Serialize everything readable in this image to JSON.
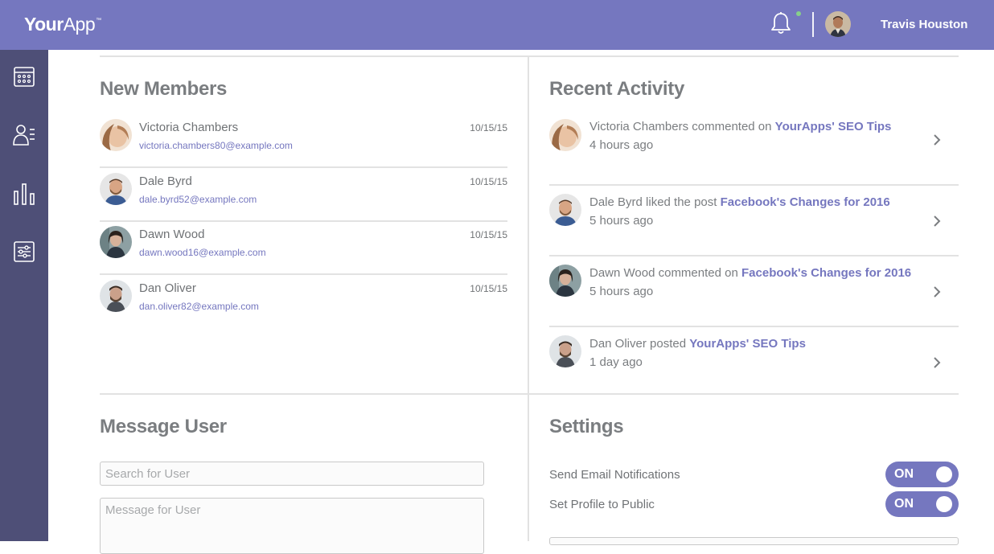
{
  "app": {
    "logo_bold": "Your",
    "logo_light": "App",
    "logo_tm": "™"
  },
  "header": {
    "user_name": "Travis Houston"
  },
  "new_members": {
    "title": "New Members",
    "items": [
      {
        "name": "Victoria Chambers",
        "email": "victoria.chambers80@example.com",
        "date": "10/15/15"
      },
      {
        "name": "Dale Byrd",
        "email": "dale.byrd52@example.com",
        "date": "10/15/15"
      },
      {
        "name": "Dawn Wood",
        "email": "dawn.wood16@example.com",
        "date": "10/15/15"
      },
      {
        "name": "Dan Oliver",
        "email": "dan.oliver82@example.com",
        "date": "10/15/15"
      }
    ]
  },
  "recent_activity": {
    "title": "Recent Activity",
    "items": [
      {
        "text": "Victoria Chambers commented on ",
        "link": "YourApps' SEO Tips",
        "time": "4 hours ago"
      },
      {
        "text": "Dale Byrd liked the post ",
        "link": "Facebook's Changes for 2016",
        "time": "5 hours ago"
      },
      {
        "text": "Dawn Wood commented on ",
        "link": "Facebook's Changes for 2016",
        "time": "5 hours ago"
      },
      {
        "text": "Dan Oliver posted ",
        "link": "YourApps' SEO Tips",
        "time": "1 day ago"
      }
    ]
  },
  "message_user": {
    "title": "Message User",
    "search_placeholder": "Search for User",
    "message_placeholder": "Message for User"
  },
  "settings": {
    "title": "Settings",
    "items": [
      {
        "label": "Send Email Notifications",
        "state": "ON"
      },
      {
        "label": "Set Profile to Public",
        "state": "ON"
      }
    ]
  },
  "colors": {
    "header": "#7577bf",
    "sidebar": "#4e4f77",
    "accent": "#7577bf",
    "notification_dot": "#87d08a"
  }
}
